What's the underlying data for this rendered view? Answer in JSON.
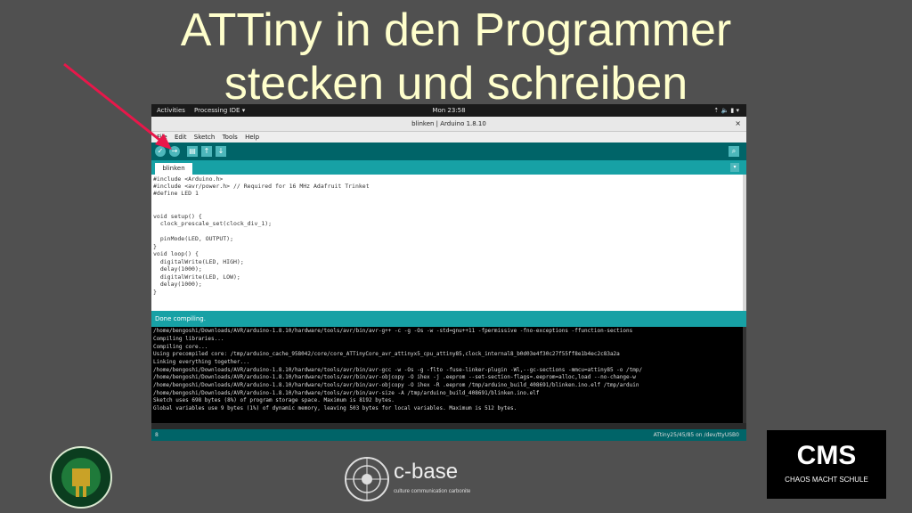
{
  "slide": {
    "title_line1": "ATTiny in den Programmer",
    "title_line2": "stecken und schreiben"
  },
  "gnome": {
    "activities": "Activities",
    "app_menu": "Processing IDE ▾",
    "clock": "Mon 23:58",
    "tray": "⇡ 🔈 ▮ ▾"
  },
  "window": {
    "title": "blinken | Arduino 1.8.10",
    "close": "×"
  },
  "menu": [
    "File",
    "Edit",
    "Sketch",
    "Tools",
    "Help"
  ],
  "toolbar": {
    "verify": "✓",
    "upload": "→",
    "new": "▤",
    "open": "↑",
    "save": "↓",
    "serial": "⌕"
  },
  "tab": {
    "name": "blinken",
    "menu": "▾"
  },
  "code": [
    "#include <Arduino.h>",
    "#include <avr/power.h> // Required for 16 MHz Adafruit Trinket",
    "#define LED 1",
    "",
    "",
    "void setup() {",
    "  clock_prescale_set(clock_div_1);",
    "",
    "  pinMode(LED, OUTPUT);",
    "}",
    "void loop() {",
    "  digitalWrite(LED, HIGH);",
    "  delay(1000);",
    "  digitalWrite(LED, LOW);",
    "  delay(1000);",
    "}"
  ],
  "status": {
    "text": "Done compiling."
  },
  "console": [
    "/home/bengoshi/Downloads/AVR/arduino-1.8.10/hardware/tools/avr/bin/avr-g++ -c -g -Os -w -std=gnu++11 -fpermissive -fno-exceptions -ffunction-sections",
    "Compiling libraries...",
    "Compiling core...",
    "Using precompiled core: /tmp/arduino_cache_958042/core/core_ATTinyCore_avr_attinyx5_cpu_attiny85,clock_internal8_b0d03e4f30c27f55ff8e1b4ec2c83a2a",
    "Linking everything together...",
    "/home/bengoshi/Downloads/AVR/arduino-1.8.10/hardware/tools/avr/bin/avr-gcc -w -Os -g -flto -fuse-linker-plugin -Wl,--gc-sections -mmcu=attiny85 -o /tmp/",
    "/home/bengoshi/Downloads/AVR/arduino-1.8.10/hardware/tools/avr/bin/avr-objcopy -O ihex -j .eeprom --set-section-flags=.eeprom=alloc,load --no-change-w",
    "/home/bengoshi/Downloads/AVR/arduino-1.8.10/hardware/tools/avr/bin/avr-objcopy -O ihex -R .eeprom /tmp/arduino_build_408691/blinken.ino.elf /tmp/arduin",
    "/home/bengoshi/Downloads/AVR/arduino-1.8.10/hardware/tools/avr/bin/avr-size -A /tmp/arduino_build_408691/blinken.ino.elf",
    "Sketch uses 698 bytes (8%) of program storage space. Maximum is 8192 bytes.",
    "Global variables use 9 bytes (1%) of dynamic memory, leaving 503 bytes for local variables. Maximum is 512 bytes."
  ],
  "footer": {
    "line": "8",
    "board": "ATtiny25/45/85 on /dev/ttyUSB0"
  },
  "logos": {
    "cbase_name": "c-base",
    "cbase_tagline": "culture communication carbonite",
    "cms_big": "CMS",
    "cms_small": "CHAOS MACHT SCHULE"
  },
  "colors": {
    "slide_bg": "#505050",
    "title": "#ffffcc",
    "arduino_dark": "#006468",
    "arduino_teal": "#17a1a5",
    "arrow": "#e8174a"
  }
}
